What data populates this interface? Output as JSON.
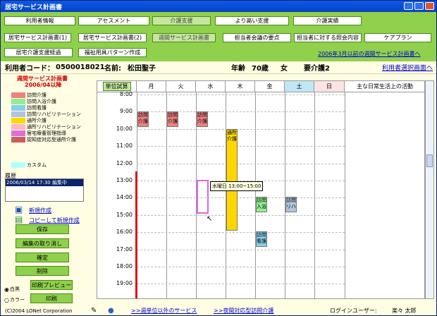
{
  "window": {
    "title": "居宅サービス計画書"
  },
  "nav_row1": [
    "利用者情報",
    "アセスメント",
    "介護支援",
    "より高い支援",
    "介護実績"
  ],
  "nav_row2": [
    "居宅サービス計画書(1)",
    "居宅サービス計画書(2)",
    "週間サービス計画書",
    "担当者会議の要点",
    "担当者に対する照会内容",
    "ケアプラン"
  ],
  "nav_row3": [
    "居宅介護支援経過",
    "福祉用具パターン作成"
  ],
  "nav_link": "2006年3月以前の週間サービス計画書へ",
  "info": {
    "code_label": "利用者コード：",
    "code": "0500018021",
    "name_label": "名前:",
    "name": "松田聖子",
    "age_label": "年齢",
    "age": "70歳",
    "sex": "女",
    "care_level": "要介護2",
    "switch_link": "利用者選択画面へ"
  },
  "plan": {
    "title": "週間サービス計画書",
    "date": "2006/04以降"
  },
  "legend": [
    {
      "label": "訪問介護",
      "color": "#f08080"
    },
    {
      "label": "訪問入浴介護",
      "color": "#90ee90"
    },
    {
      "label": "訪問看護",
      "color": "#87ceeb"
    },
    {
      "label": "訪問リハビリテーション",
      "color": "#b0c4de"
    },
    {
      "label": "通所介護",
      "color": "#ffd700"
    },
    {
      "label": "通所リハビリテーション",
      "color": "#ffb6c1"
    },
    {
      "label": "居宅療養管理指導",
      "color": "#da70d6"
    },
    {
      "label": "認知症対応型通所介護",
      "color": "#cd5c5c"
    }
  ],
  "custom_label": "カスタム",
  "history": {
    "label": "履歴",
    "entry": "2006/03/14 17:30 編集中"
  },
  "links": {
    "new": "新規作成",
    "copy_new": "コピーして新規作成"
  },
  "buttons": {
    "save": "保存",
    "cancel_edit": "編集の取り消し",
    "confirm": "確定",
    "delete": "削除",
    "print_preview": "印刷プレビュー",
    "print": "印刷"
  },
  "radio": {
    "mono": "白黒",
    "color": "カラー"
  },
  "schedule": {
    "calc_button": "単位試算",
    "days": [
      "月",
      "火",
      "水",
      "木",
      "金",
      "土",
      "日"
    ],
    "activity_header": "主な日常生活上の活動",
    "hours": [
      "8:00",
      "9:00",
      "10:00",
      "11:00",
      "12:00",
      "13:00",
      "14:00",
      "15:00",
      "16:00",
      "17:00",
      "18:00",
      "19:00"
    ],
    "blocks": [
      {
        "day": 0,
        "text": "訪問\n介護",
        "color": "#f08080"
      },
      {
        "day": 1,
        "text": "訪問\n介護",
        "color": "#f08080"
      },
      {
        "day": 2,
        "text": "訪問\n介護",
        "color": "#f08080"
      },
      {
        "day": 3,
        "text": "通所\n介護",
        "color": "#ffd700"
      },
      {
        "day": 4,
        "text": "訪問\n入浴",
        "color": "#90ee90"
      },
      {
        "day": 5,
        "text": "訪問\nリハ",
        "color": "#b0c4de"
      },
      {
        "day": 4,
        "text": "訪問\n看護",
        "color": "#87ceeb"
      }
    ],
    "tooltip": "水曜日 13:00~15:00"
  },
  "footer": {
    "copyright": "(C)2004 LONet Corporation",
    "link1": ">>週単位以外のサービス",
    "link2": ">>夜間対応型訪問介護",
    "login_label": "ログインユーザー:",
    "login_user": "楽々 太郎"
  }
}
